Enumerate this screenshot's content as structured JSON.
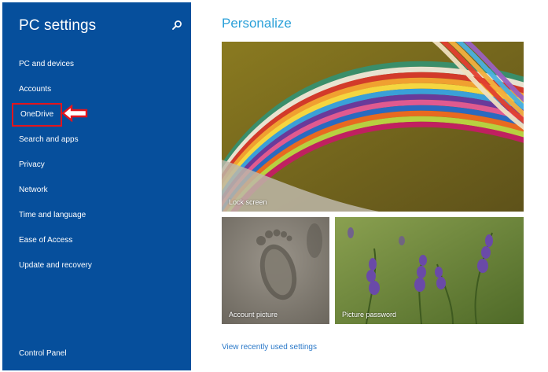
{
  "sidebar": {
    "title": "PC settings",
    "items": [
      {
        "label": "PC and devices"
      },
      {
        "label": "Accounts"
      },
      {
        "label": "OneDrive"
      },
      {
        "label": "Search and apps"
      },
      {
        "label": "Privacy"
      },
      {
        "label": "Network"
      },
      {
        "label": "Time and language"
      },
      {
        "label": "Ease of Access"
      },
      {
        "label": "Update and recovery"
      }
    ],
    "footer_link": "Control Panel",
    "search_icon": "search-icon",
    "highlight_color": "#e3151c",
    "background_color": "#064f9c"
  },
  "main": {
    "title": "Personalize",
    "tiles": {
      "lock_screen": "Lock screen",
      "account_picture": "Account picture",
      "picture_password": "Picture password"
    },
    "recent_link": "View recently used settings",
    "accent_color": "#2aa0d9"
  }
}
